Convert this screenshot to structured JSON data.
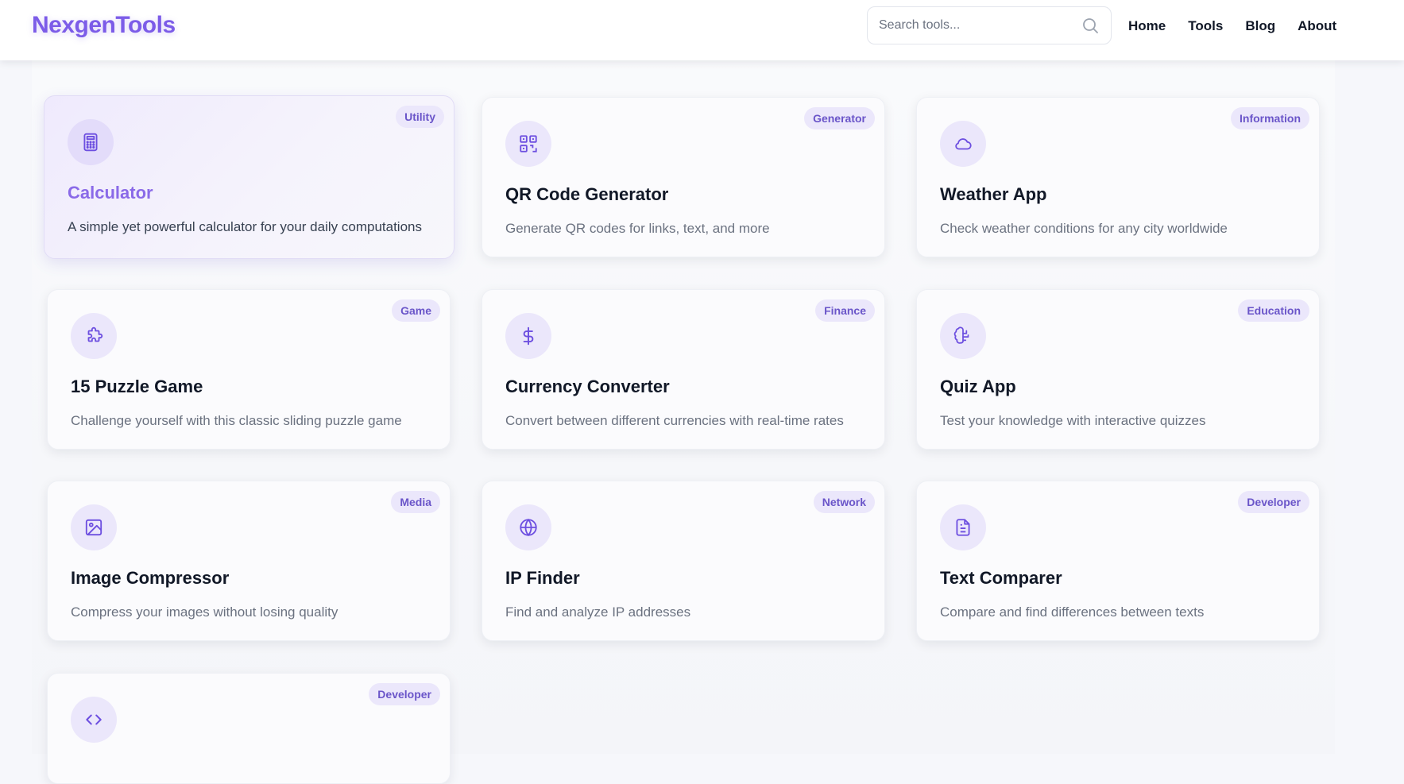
{
  "header": {
    "logo": "NexgenTools",
    "search": {
      "placeholder": "Search tools...",
      "value": ""
    },
    "nav": [
      "Home",
      "Tools",
      "Blog",
      "About"
    ]
  },
  "colors": {
    "accent": "#7c5ce8",
    "badge_bg": "#ebe7fb",
    "badge_text": "#6a55c9"
  },
  "tools": [
    {
      "title": "Calculator",
      "description": "A simple yet powerful calculator for your daily computations",
      "category": "Utility",
      "icon": "calculator-icon"
    },
    {
      "title": "QR Code Generator",
      "description": "Generate QR codes for links, text, and more",
      "category": "Generator",
      "icon": "qr-code-icon"
    },
    {
      "title": "Weather App",
      "description": "Check weather conditions for any city worldwide",
      "category": "Information",
      "icon": "cloud-icon"
    },
    {
      "title": "15 Puzzle Game",
      "description": "Challenge yourself with this classic sliding puzzle game",
      "category": "Game",
      "icon": "puzzle-icon"
    },
    {
      "title": "Currency Converter",
      "description": "Convert between different currencies with real-time rates",
      "category": "Finance",
      "icon": "dollar-icon"
    },
    {
      "title": "Quiz App",
      "description": "Test your knowledge with interactive quizzes",
      "category": "Education",
      "icon": "brain-icon"
    },
    {
      "title": "Image Compressor",
      "description": "Compress your images without losing quality",
      "category": "Media",
      "icon": "image-icon"
    },
    {
      "title": "IP Finder",
      "description": "Find and analyze IP addresses",
      "category": "Network",
      "icon": "globe-icon"
    },
    {
      "title": "Text Comparer",
      "description": "Compare and find differences between texts",
      "category": "Developer",
      "icon": "document-icon"
    },
    {
      "title": "",
      "description": "",
      "category": "Developer",
      "icon": "code-icon"
    }
  ]
}
